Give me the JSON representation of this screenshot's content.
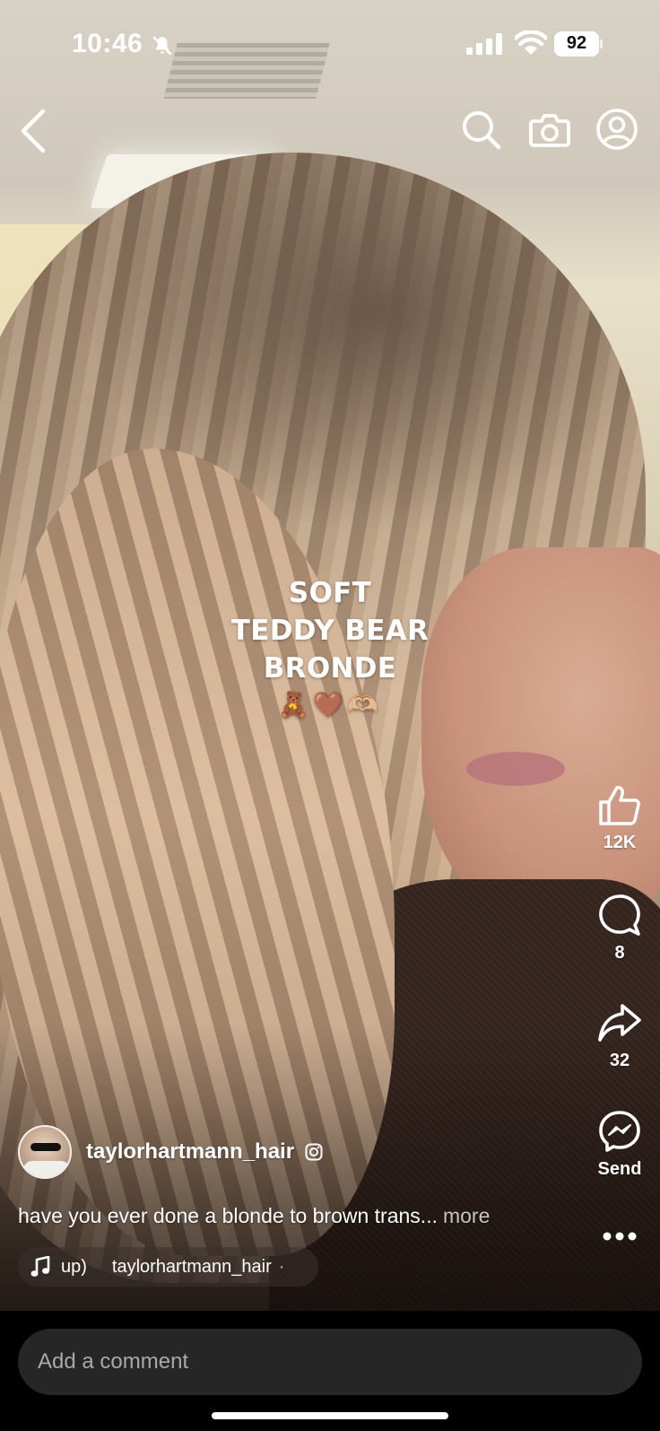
{
  "status_bar": {
    "time": "10:46",
    "battery": "92",
    "icons": [
      "bell-slash-icon",
      "cellular-signal-icon",
      "wifi-icon",
      "battery-icon"
    ]
  },
  "nav": {
    "icons": [
      "chevron-left-icon",
      "search-icon",
      "camera-icon",
      "profile-icon"
    ]
  },
  "overlay": {
    "line1": "SOFT",
    "line2": "TEDDY BEAR",
    "line3": "BRONDE",
    "emoji": "🧸🤎🫶🏼"
  },
  "actions": {
    "like_count": "12K",
    "comment_count": "8",
    "share_count": "32",
    "send_label": "Send"
  },
  "author": {
    "username": "taylorhartmann_hair"
  },
  "caption": {
    "text": "have you ever done a blonde to brown trans...",
    "more": "more"
  },
  "audio": {
    "fragment": "up)",
    "artist": "taylorhartmann_hair",
    "separator": "·"
  },
  "comment": {
    "placeholder": "Add a comment"
  },
  "colors": {
    "background": "#000000",
    "comment_field": "#262626",
    "text": "#ffffff",
    "muted_text": "#a8a8a8"
  }
}
